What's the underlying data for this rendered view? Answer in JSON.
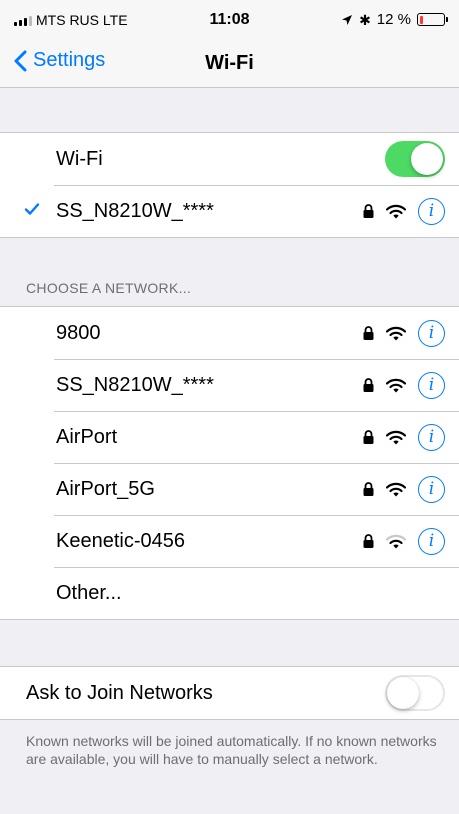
{
  "status_bar": {
    "carrier": "MTS RUS  LTE",
    "time": "11:08",
    "battery_text": "12 %",
    "battery_level": 0.12,
    "battery_color": "#ff3b30"
  },
  "nav": {
    "back_label": "Settings",
    "title": "Wi-Fi"
  },
  "wifi": {
    "label": "Wi-Fi",
    "enabled": true,
    "connected_network": "SS_N8210W_****"
  },
  "networks": {
    "header": "CHOOSE A NETWORK...",
    "items": [
      {
        "name": "9800",
        "secured": true
      },
      {
        "name": "SS_N8210W_****",
        "secured": true
      },
      {
        "name": "AirPort",
        "secured": true
      },
      {
        "name": "AirPort_5G",
        "secured": true
      },
      {
        "name": "Keenetic-0456",
        "secured": true
      }
    ],
    "other_label": "Other..."
  },
  "ask_to_join": {
    "label": "Ask to Join Networks",
    "enabled": false,
    "footer": "Known networks will be joined automatically. If no known networks are available, you will have to manually select a network."
  },
  "icons": {
    "back": "chevron-left-icon",
    "check": "checkmark-icon",
    "lock": "lock-icon",
    "wifi": "wifi-icon",
    "info": "info-icon",
    "location": "location-arrow-icon",
    "bluetooth": "bluetooth-icon"
  },
  "colors": {
    "accent": "#007aff",
    "toggle_on": "#4cd964",
    "background": "#efeff4"
  }
}
